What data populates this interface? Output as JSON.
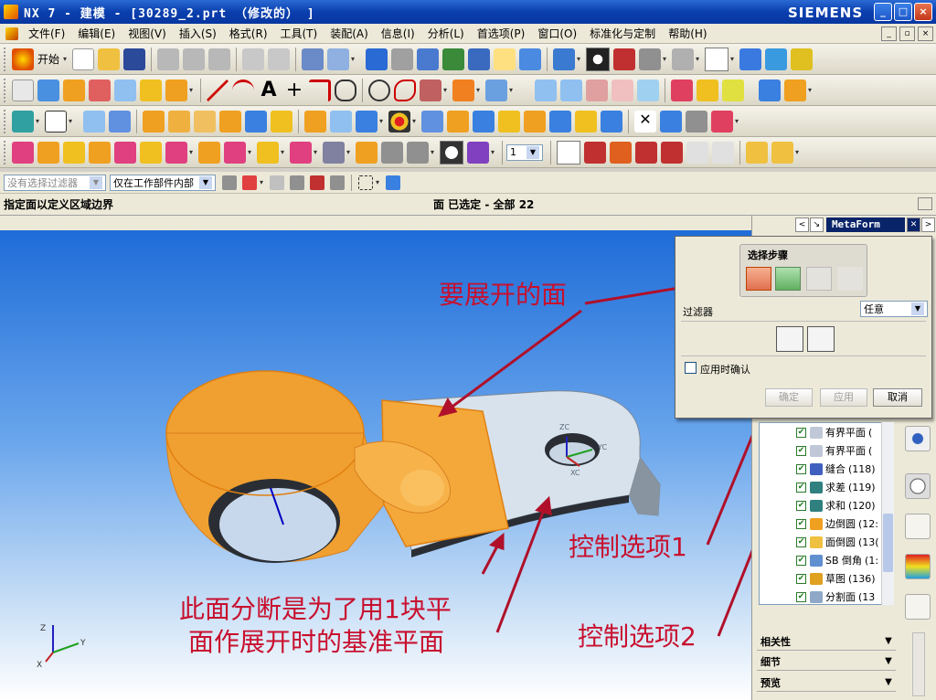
{
  "window": {
    "title": "NX 7 - 建模 - [30289_2.prt （修改的） ]",
    "brand": "SIEMENS",
    "controls": [
      "_",
      "□",
      "×"
    ]
  },
  "menu": [
    "文件(F)",
    "编辑(E)",
    "视图(V)",
    "插入(S)",
    "格式(R)",
    "工具(T)",
    "装配(A)",
    "信息(I)",
    "分析(L)",
    "首选项(P)",
    "窗口(O)",
    "标准化与定制",
    "帮助(H)"
  ],
  "toolbar": {
    "start_label": "开始"
  },
  "filters": {
    "type_filter": "没有选择过滤器",
    "scope": "仅在工作部件内部"
  },
  "status": {
    "prompt": "指定面以定义区域边界",
    "selection": "面 已选定 - 全部 22"
  },
  "metaform": {
    "title": "MetaForm",
    "nav_prev": "<",
    "nav_pin": "↘",
    "nav_close": "✕",
    "nav_next": ">"
  },
  "dialog": {
    "group_label": "选择步骤",
    "filter_label": "过滤器",
    "filter_value": "任意",
    "confirm_on_apply": "应用时确认",
    "ok": "确定",
    "apply": "应用",
    "cancel": "取消"
  },
  "feature_tree": [
    {
      "name": "有界平面",
      "id": "("
    },
    {
      "name": "有界平面",
      "id": "("
    },
    {
      "name": "缝合",
      "id": "(118)"
    },
    {
      "name": "求差",
      "id": "(119)"
    },
    {
      "name": "求和",
      "id": "(120)"
    },
    {
      "name": "边倒圆",
      "id": "(12:"
    },
    {
      "name": "面倒圆",
      "id": "(13("
    },
    {
      "name": "SB 倒角",
      "id": "(1:"
    },
    {
      "name": "草图",
      "id": "(136)"
    },
    {
      "name": "分割面",
      "id": "(13"
    }
  ],
  "sections": [
    "相关性",
    "细节",
    "预览"
  ],
  "annotations": {
    "face_to_unfold": "要展开的面",
    "split_note_1": "此面分断是为了用1块平",
    "split_note_2": "面作展开时的基准平面",
    "control_1": "控制选项1",
    "control_2": "控制选项2"
  },
  "model_labels": {
    "xc": "XC",
    "yc": "YC",
    "zc": "ZC",
    "x": "X",
    "y": "Y",
    "z": "Z"
  },
  "colors": {
    "title_bar": "#0a3fae",
    "part_orange": "#f0a030",
    "part_face": "#d8e2ec",
    "annotation": "#c8102e",
    "viewport_top": "#1e6cd8"
  }
}
